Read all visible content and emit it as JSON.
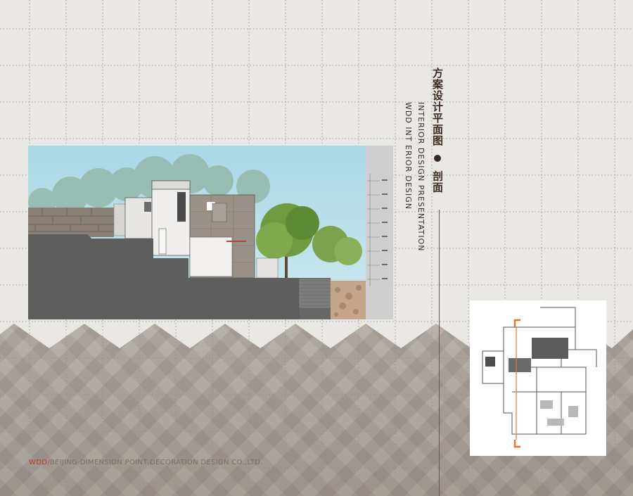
{
  "title": {
    "cn_main": "方案设计平面图",
    "cn_sub": "剖面",
    "en_line1": "INTERIOR DESIGN PRESENTATION",
    "en_line2": "WDD INT ERIOR DESIGN"
  },
  "footer": {
    "brand": "WDD",
    "company": "/BEIJING DIMENSION POINT DECORATION DESIGN CO.,LTD."
  },
  "colors": {
    "accent_red": "#c0392b",
    "title_brown": "#3a2b22",
    "plan_marker_orange": "#e8752a"
  }
}
